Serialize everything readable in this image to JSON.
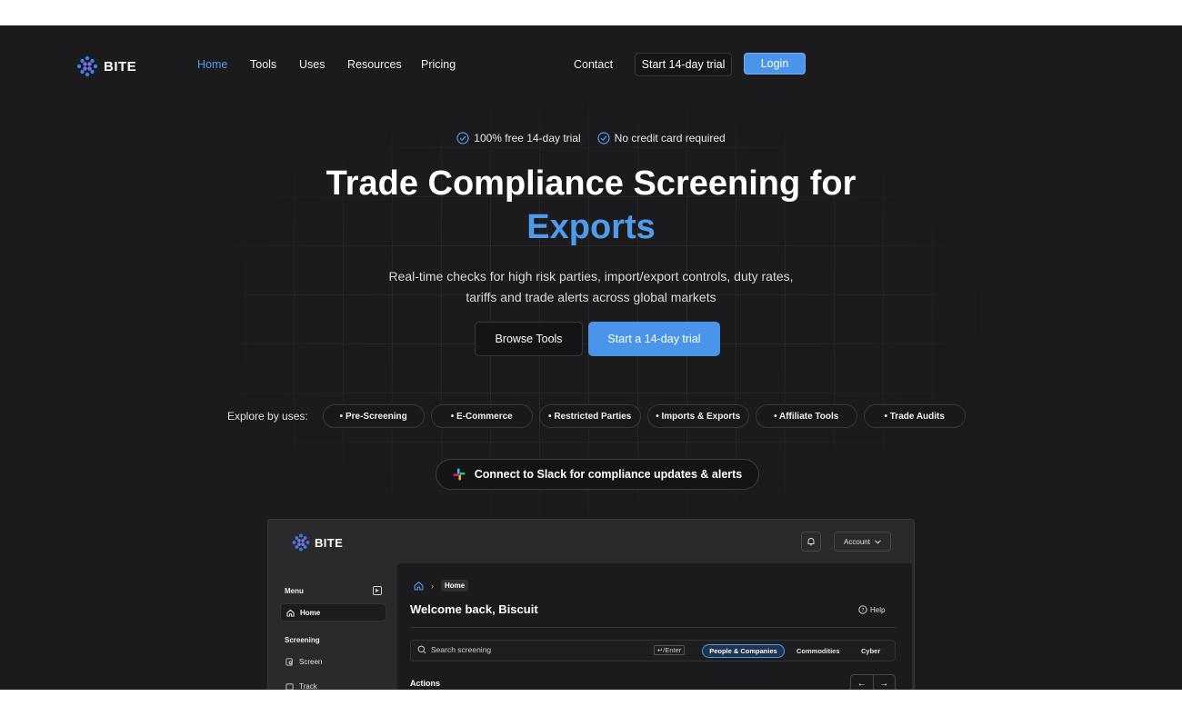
{
  "brand": {
    "name": "BITE"
  },
  "nav": {
    "links": [
      "Home",
      "Tools",
      "Uses",
      "Resources",
      "Pricing"
    ],
    "contact": "Contact",
    "trial_button": "Start 14-day trial",
    "login_button": "Login"
  },
  "hero": {
    "badges": [
      "100% free 14-day trial",
      "No credit card required"
    ],
    "title_line1": "Trade Compliance Screening for",
    "title_accent": "Exports",
    "subtitle_line1": "Real-time checks for high risk parties, import/export controls, duty rates,",
    "subtitle_line2": "tariffs and trade alerts across global markets",
    "browse_button": "Browse Tools",
    "start_button": "Start a 14-day trial"
  },
  "explore": {
    "label": "Explore by uses:",
    "chips": [
      "• Pre-Screening",
      "• E-Commerce",
      "• Restricted Parties",
      "• Imports & Exports",
      "• Affiliate Tools",
      "• Trade Audits"
    ]
  },
  "slack": {
    "label": "Connect to Slack for compliance updates & alerts"
  },
  "preview": {
    "brand": "BITE",
    "account": "Account",
    "menu_label": "Menu",
    "home_item": "Home",
    "screening_section": "Screening",
    "items": [
      "Screen",
      "Track"
    ],
    "breadcrumb_home": "Home",
    "welcome": "Welcome back, Biscuit",
    "help": "Help",
    "search_placeholder": "Search screening",
    "enter_hint": "↵/Enter",
    "tabs": [
      "People & Companies",
      "Commodities",
      "Cyber"
    ],
    "actions_label": "Actions"
  },
  "colors": {
    "accent": "#4a95ea",
    "background": "#1b1b1d"
  }
}
